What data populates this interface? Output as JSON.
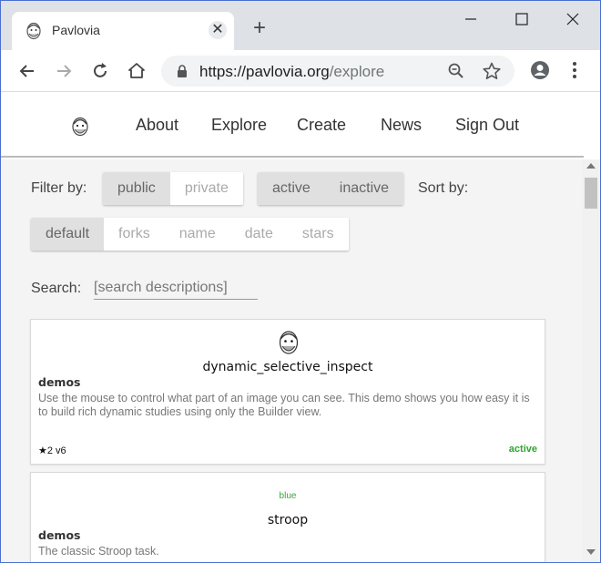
{
  "browser": {
    "tab_title": "Pavlovia",
    "new_tab_symbol": "+",
    "close_tab_symbol": "✕",
    "url_host": "https://pavlovia.org",
    "url_path": "/explore"
  },
  "nav": {
    "items": [
      {
        "label": "About"
      },
      {
        "label": "Explore"
      },
      {
        "label": "Create"
      },
      {
        "label": "News"
      },
      {
        "label": "Sign Out"
      }
    ]
  },
  "filters": {
    "filter_label": "Filter by:",
    "visibility": [
      {
        "label": "public",
        "active": true
      },
      {
        "label": "private",
        "active": false
      }
    ],
    "status": [
      {
        "label": "active",
        "active": true
      },
      {
        "label": "inactive",
        "active": true
      }
    ],
    "sort_label": "Sort by:",
    "sort": [
      {
        "label": "default",
        "active": true
      },
      {
        "label": "forks",
        "active": false
      },
      {
        "label": "name",
        "active": false
      },
      {
        "label": "date",
        "active": false
      },
      {
        "label": "stars",
        "active": false
      }
    ],
    "search_label": "Search:",
    "search_placeholder": "[search descriptions]",
    "search_value": ""
  },
  "projects": [
    {
      "title": "dynamic_selective_inspect",
      "group": "demos",
      "description": "Use the mouse to control what part of an image you can see. This demo shows you how easy it is to build rich dynamic studies using only the Builder view.",
      "stars": "★2",
      "version": "v6",
      "status": "active"
    },
    {
      "tag": "blue",
      "title": "stroop",
      "group": "demos",
      "description": "The classic Stroop task."
    }
  ],
  "colors": {
    "active_green": "#2ea52e",
    "selected_segment": "#e0e0e0",
    "content_bg": "#f4f4f4",
    "tabstrip_bg": "#dee1e6"
  }
}
